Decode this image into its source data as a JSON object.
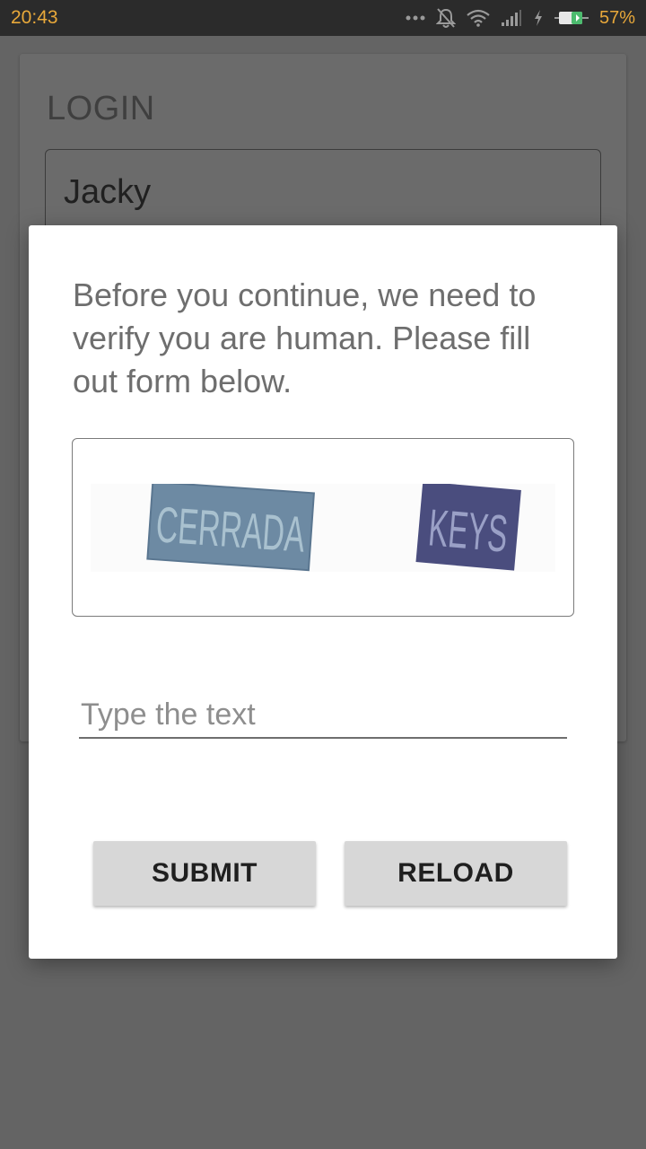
{
  "status_bar": {
    "time": "20:43",
    "battery_percent": "57%",
    "icons": [
      "more-dots-icon",
      "notifications-off-icon",
      "wifi-icon",
      "signal-icon",
      "charging-icon",
      "battery-icon"
    ]
  },
  "login_card": {
    "title": "LOGIN",
    "username_value": "Jacky"
  },
  "dialog": {
    "message": "Before you continue, we need to verify you are human. Please fill out form below.",
    "captcha_words": [
      "CERRADA",
      "KEYS"
    ],
    "input_placeholder": "Type the text",
    "submit_label": "SUBMIT",
    "reload_label": "RELOAD"
  },
  "colors": {
    "status_bar_bg": "#2b2b2b",
    "status_accent": "#e8a83a",
    "scrim": "#646464",
    "dialog_bg": "#ffffff",
    "button_bg": "#d7d7d7"
  }
}
